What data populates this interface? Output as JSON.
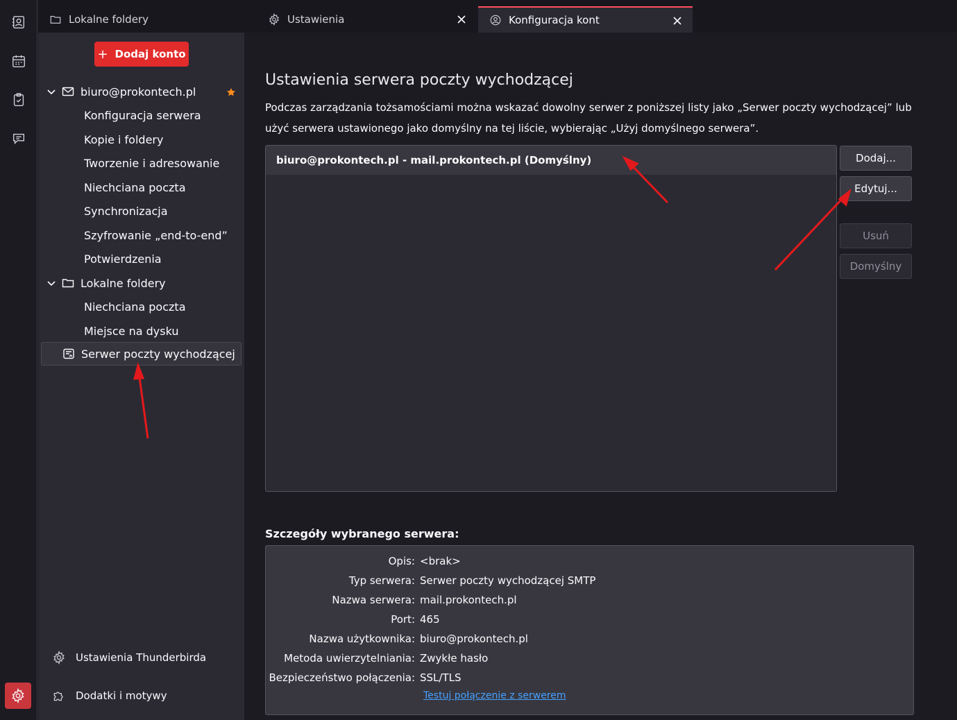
{
  "tabs": [
    {
      "label": "Lokalne foldery",
      "icon": "folder-icon"
    },
    {
      "label": "Ustawienia",
      "icon": "gear-icon"
    },
    {
      "label": "Konfiguracja kont",
      "icon": "account-settings-icon"
    }
  ],
  "sidebar": {
    "add_account_label": "Dodaj konto",
    "account": {
      "name": "biuro@prokontech.pl",
      "children": [
        "Konfiguracja serwera",
        "Kopie i foldery",
        "Tworzenie i adresowanie",
        "Niechciana poczta",
        "Synchronizacja",
        "Szyfrowanie „end-to-end”",
        "Potwierdzenia"
      ]
    },
    "local_folders": {
      "name": "Lokalne foldery",
      "children": [
        "Niechciana poczta",
        "Miejsce na dysku"
      ]
    },
    "outgoing_server_label": "Serwer poczty wychodzącej",
    "footer": {
      "settings_label": "Ustawienia Thunderbirda",
      "addons_label": "Dodatki i motywy"
    }
  },
  "main": {
    "title": "Ustawienia serwera poczty wychodzącej",
    "description": "Podczas zarządzania tożsamościami można wskazać dowolny serwer z poniższej listy jako „Serwer poczty wychodzącej” lub użyć serwera ustawionego jako domyślny na tej liście, wybierając „Użyj domyślnego serwera”.",
    "servers": [
      "biuro@prokontech.pl - mail.prokontech.pl (Domyślny)"
    ],
    "buttons": {
      "add": "Dodaj...",
      "edit": "Edytuj...",
      "remove": "Usuń",
      "default": "Domyślny"
    },
    "details_title": "Szczegóły wybranego serwera:",
    "details": [
      {
        "label": "Opis:",
        "value": "<brak>"
      },
      {
        "label": "Typ serwera:",
        "value": "Serwer poczty wychodzącej SMTP"
      },
      {
        "label": "Nazwa serwera:",
        "value": "mail.prokontech.pl"
      },
      {
        "label": "Port:",
        "value": "465"
      },
      {
        "label": "Nazwa użytkownika:",
        "value": "biuro@prokontech.pl"
      },
      {
        "label": "Metoda uwierzytelniania:",
        "value": "Zwykłe hasło"
      },
      {
        "label": "Bezpieczeństwo połączenia:",
        "value": "SSL/TLS"
      }
    ],
    "test_link": "Testuj połączenie z serwerem"
  },
  "colors": {
    "accent": "#e22b2b",
    "link": "#45a1ff",
    "star": "#ff8c1a",
    "annotation_arrow": "#e3191c"
  }
}
